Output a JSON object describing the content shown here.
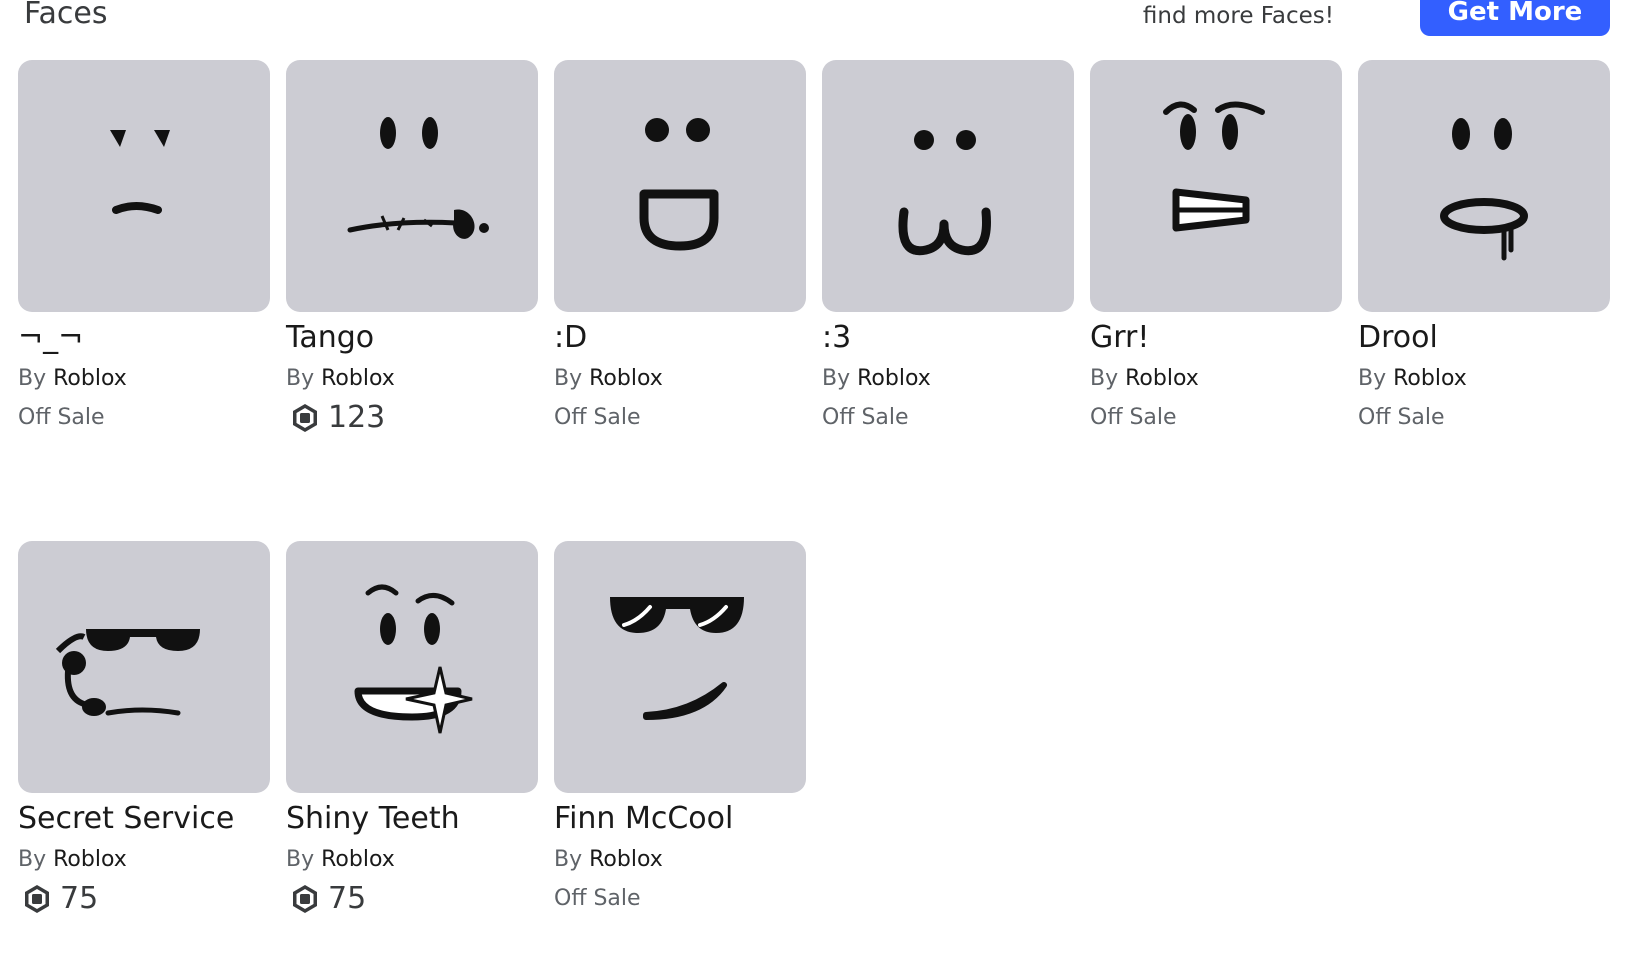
{
  "section": {
    "title": "Faces",
    "find_more_text": "find more Faces!",
    "get_more_label": "Get More"
  },
  "items": [
    {
      "name": "¬_¬",
      "by_label": "By",
      "creator": "Roblox",
      "price": "Off Sale",
      "on_sale": false,
      "face": "face-unimpressed"
    },
    {
      "name": "Tango",
      "by_label": "By",
      "creator": "Roblox",
      "price": "123",
      "on_sale": true,
      "face": "face-tango"
    },
    {
      "name": ":D",
      "by_label": "By",
      "creator": "Roblox",
      "price": "Off Sale",
      "on_sale": false,
      "face": "face-big-grin"
    },
    {
      "name": ":3",
      "by_label": "By",
      "creator": "Roblox",
      "price": "Off Sale",
      "on_sale": false,
      "face": "face-cat"
    },
    {
      "name": "Grr!",
      "by_label": "By",
      "creator": "Roblox",
      "price": "Off Sale",
      "on_sale": false,
      "face": "face-grr"
    },
    {
      "name": "Drool",
      "by_label": "By",
      "creator": "Roblox",
      "price": "Off Sale",
      "on_sale": false,
      "face": "face-drool"
    },
    {
      "name": "Secret Service",
      "by_label": "By",
      "creator": "Roblox",
      "price": "75",
      "on_sale": true,
      "face": "face-secret-service"
    },
    {
      "name": "Shiny Teeth",
      "by_label": "By",
      "creator": "Roblox",
      "price": "75",
      "on_sale": true,
      "face": "face-shiny-teeth"
    },
    {
      "name": "Finn McCool",
      "by_label": "By",
      "creator": "Roblox",
      "price": "Off Sale",
      "on_sale": false,
      "face": "face-finn-mccool"
    }
  ],
  "colors": {
    "accent": "#335fff",
    "thumb_bg": "#ccccd3",
    "robux_icon": "#393b3d"
  }
}
